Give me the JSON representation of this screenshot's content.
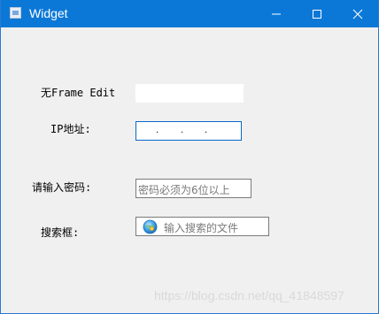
{
  "window": {
    "title": "Widget",
    "icons": {
      "app": "app-window-icon",
      "minimize": "minimize-icon",
      "maximize": "maximize-icon",
      "close": "close-icon"
    },
    "accent_color": "#0b78d7"
  },
  "form": {
    "noframe_label": "无Frame Edit",
    "noframe_value": "",
    "ip_label": "IP地址:",
    "ip_dots": [
      ".",
      ".",
      "."
    ],
    "password_label": "请输入密码:",
    "password_placeholder": "密码必须为6位以上",
    "search_label": "搜索框:",
    "search_placeholder": "输入搜索的文件",
    "search_icon": "search-globe-icon"
  },
  "watermark": "https://blog.csdn.net/qq_41848597"
}
